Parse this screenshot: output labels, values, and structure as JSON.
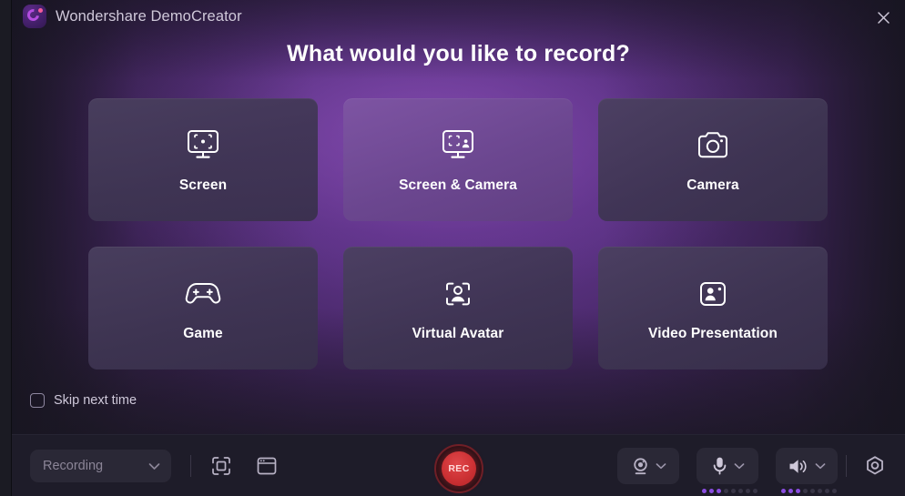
{
  "window": {
    "app_title": "Wondershare DemoCreator",
    "logo_icon": "democreator-logo-icon",
    "close_icon": "close-icon"
  },
  "headline": "What would you like to record?",
  "cards": [
    {
      "label": "Screen",
      "icon": "monitor-capture-icon",
      "selected": false
    },
    {
      "label": "Screen & Camera",
      "icon": "monitor-camera-icon",
      "selected": true
    },
    {
      "label": "Camera",
      "icon": "camera-icon",
      "selected": false
    },
    {
      "label": "Game",
      "icon": "gamepad-icon",
      "selected": false
    },
    {
      "label": "Virtual Avatar",
      "icon": "avatar-scan-icon",
      "selected": false
    },
    {
      "label": "Video Presentation",
      "icon": "person-slide-icon",
      "selected": false
    }
  ],
  "skip": {
    "label": "Skip next time",
    "checked": false
  },
  "toolbar": {
    "mode_select": {
      "value": "Recording",
      "caret_icon": "chevron-down-icon"
    },
    "fullscreen_icon": "capture-region-icon",
    "window_icon": "window-capture-icon",
    "record_button_label": "REC",
    "devices": [
      {
        "name": "webcam",
        "icon": "webcam-icon",
        "caret_icon": "chevron-down-icon",
        "meter_on": 0,
        "meter_total": 0
      },
      {
        "name": "microphone",
        "icon": "microphone-icon",
        "caret_icon": "chevron-down-icon",
        "meter_on": 3,
        "meter_total": 8
      },
      {
        "name": "speaker",
        "icon": "speaker-icon",
        "caret_icon": "chevron-down-icon",
        "meter_on": 3,
        "meter_total": 8
      }
    ],
    "settings_icon": "gear-icon"
  },
  "colors": {
    "accent_purple": "#8a4de0",
    "record_red": "#cc3134",
    "card_bg": "#3e3552",
    "card_selected_bg": "#6b478f",
    "toolbar_bg": "#1e1c29"
  }
}
